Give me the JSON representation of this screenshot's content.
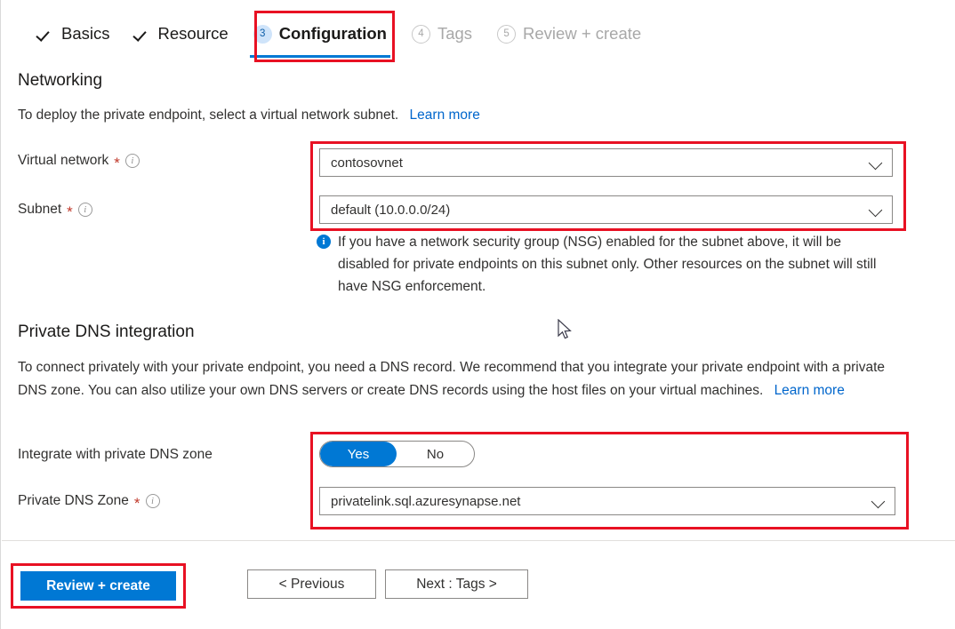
{
  "wizard": {
    "tabs": [
      {
        "label": "Basics",
        "state": "done",
        "marker": "check",
        "number": ""
      },
      {
        "label": "Resource",
        "state": "done",
        "marker": "check",
        "number": ""
      },
      {
        "label": "Configuration",
        "state": "active",
        "marker": "number",
        "number": "3"
      },
      {
        "label": "Tags",
        "state": "disabled",
        "marker": "number",
        "number": "4"
      },
      {
        "label": "Review + create",
        "state": "disabled",
        "marker": "number",
        "number": "5"
      }
    ]
  },
  "networking": {
    "heading": "Networking",
    "description": "To deploy the private endpoint, select a virtual network subnet.",
    "learn_more": "Learn more",
    "virtual_network": {
      "label": "Virtual network",
      "required_mark": "*",
      "value": "contosovnet"
    },
    "subnet": {
      "label": "Subnet",
      "required_mark": "*",
      "value": "default (10.0.0.0/24)"
    },
    "nsg_notice": "If you have a network security group (NSG) enabled for the subnet above, it will be disabled for private endpoints on this subnet only. Other resources on the subnet will still have NSG enforcement."
  },
  "private_dns": {
    "heading": "Private DNS integration",
    "description": "To connect privately with your private endpoint, you need a DNS record. We recommend that you integrate your private endpoint with a private DNS zone. You can also utilize your own DNS servers or create DNS records using the host files on your virtual machines.",
    "learn_more": "Learn more",
    "integrate_toggle": {
      "label": "Integrate with private DNS zone",
      "options": [
        "Yes",
        "No"
      ],
      "selected": "Yes"
    },
    "dns_zone": {
      "label": "Private DNS Zone",
      "required_mark": "*",
      "value": "privatelink.sql.azuresynapse.net"
    }
  },
  "footer": {
    "review_create": "Review + create",
    "previous": "< Previous",
    "next": "Next : Tags >"
  },
  "colors": {
    "accent": "#0078d4",
    "highlight": "#e81123",
    "link": "#0066cc",
    "required": "#c0392b"
  }
}
